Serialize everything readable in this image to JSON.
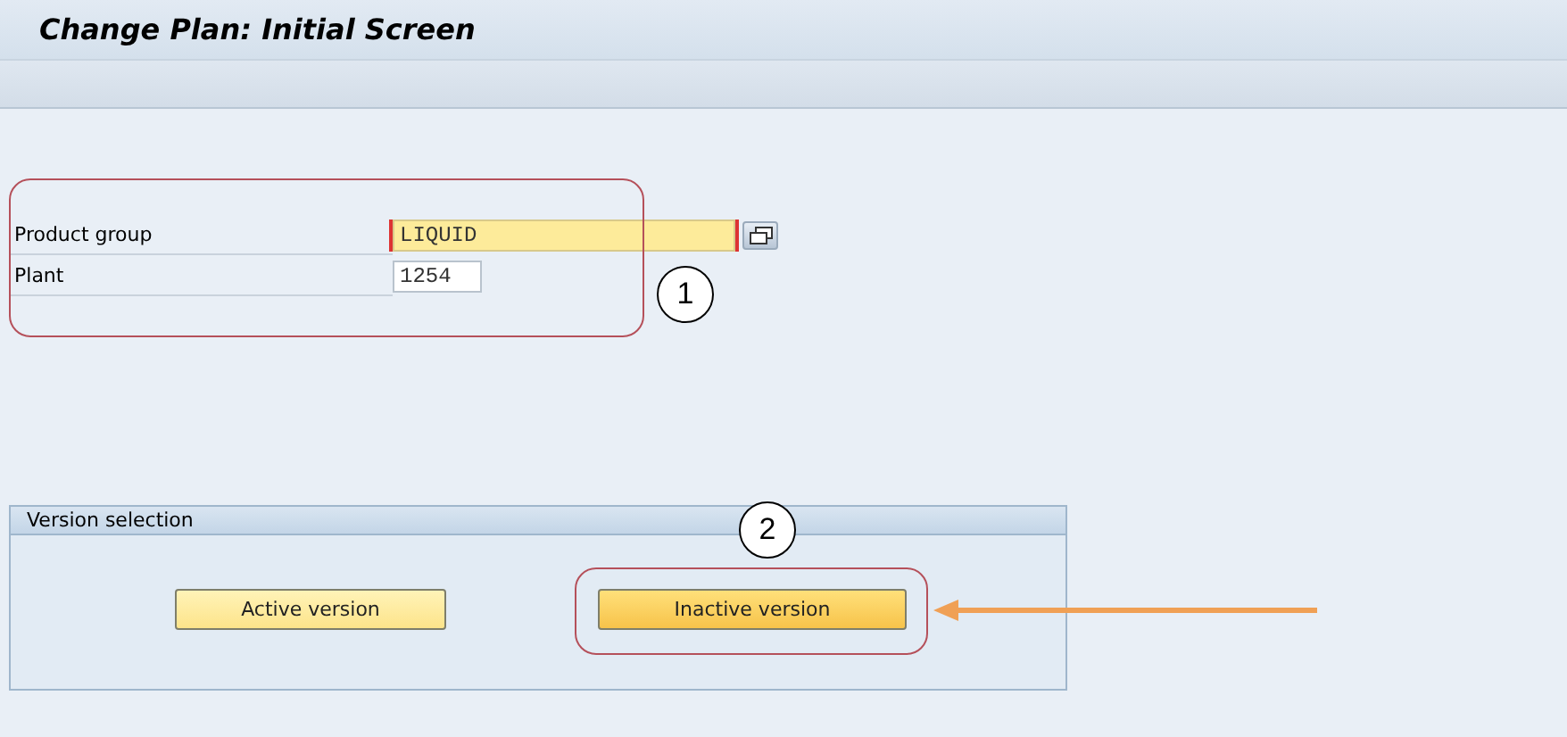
{
  "window": {
    "title": "Change Plan: Initial Screen"
  },
  "fields": [
    {
      "label": "Product group",
      "value": "LIQUID",
      "focused": true,
      "has_lookup": true
    },
    {
      "label": "Plant",
      "value": "1254",
      "focused": false,
      "has_lookup": false
    }
  ],
  "version_selection": {
    "title": "Version selection",
    "buttons": [
      {
        "label": "Active version",
        "emphasized": false
      },
      {
        "label": "Inactive version",
        "emphasized": true
      }
    ]
  },
  "callouts": [
    {
      "label": "1"
    },
    {
      "label": "2"
    }
  ]
}
